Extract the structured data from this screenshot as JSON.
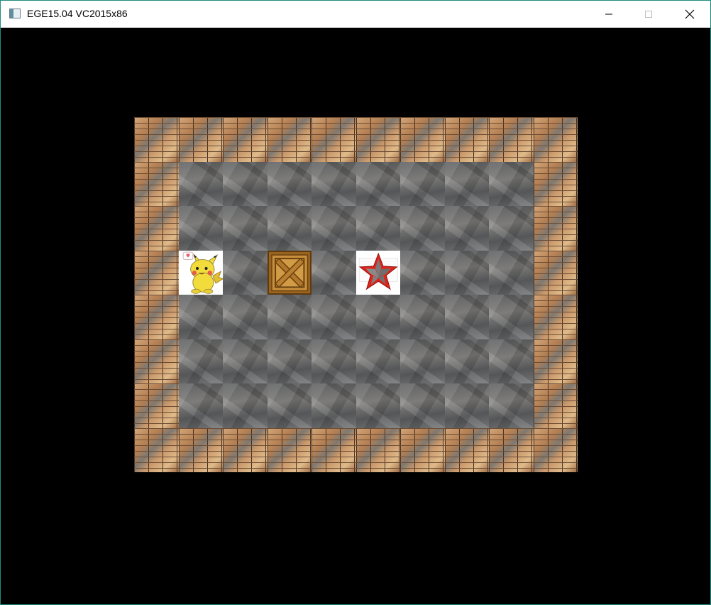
{
  "window": {
    "title": "EGE15.04 VC2015x86"
  },
  "controls": {
    "minimize": "minimize",
    "maximize": "maximize",
    "close": "close"
  },
  "level": {
    "columns": 10,
    "rows": 8,
    "grid": [
      "WWWWWWWWWW",
      "WFFFFFFFFW",
      "WFFFFFFFFW",
      "WPFBFTFFFW",
      "WFFFFFFFFW",
      "WFFFFFFFFW",
      "WFFFFFFFFW",
      "WWWWWWWWWW"
    ]
  },
  "legend": {
    "W": "wall",
    "F": "floor",
    "P": "player",
    "B": "box",
    "T": "target"
  },
  "colors": {
    "background": "#000000",
    "titlebar": "#ffffff",
    "window_border": "#1e8c7e",
    "wall": "#a9784e",
    "floor": "#676767",
    "box": "#c8903d",
    "target_star": "#e2231a",
    "player": "#f2dc3c"
  }
}
